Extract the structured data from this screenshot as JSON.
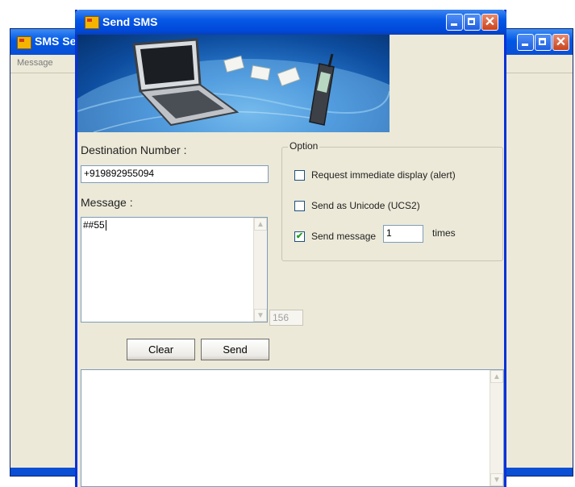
{
  "background_window": {
    "title": "SMS Ser",
    "menu": [
      "Message"
    ]
  },
  "window": {
    "title": "Send SMS",
    "destination_label": "Destination Number :",
    "destination_value": "+919892955094",
    "message_label": "Message :",
    "message_value": "##55",
    "char_count": "156",
    "clear_button": "Clear",
    "send_button": "Send",
    "options": {
      "legend": "Option",
      "alert_label": "Request immediate display (alert)",
      "alert_checked": false,
      "unicode_label": "Send as Unicode (UCS2)",
      "unicode_checked": false,
      "repeat_label": "Send message",
      "repeat_checked": true,
      "repeat_count": "1",
      "repeat_suffix": "times"
    },
    "log_text": ""
  },
  "icons": [
    "app-icon",
    "minimize-icon",
    "maximize-icon",
    "close-icon",
    "laptop-icon",
    "envelope-icon",
    "mobile-phone-icon",
    "globe-image",
    "scroll-up-icon",
    "scroll-down-icon",
    "check-icon"
  ],
  "colors": {
    "titlebar": "#0058e6",
    "window_bg": "#ece9d8",
    "close_button": "#d2532c",
    "check_mark": "#21a121"
  }
}
